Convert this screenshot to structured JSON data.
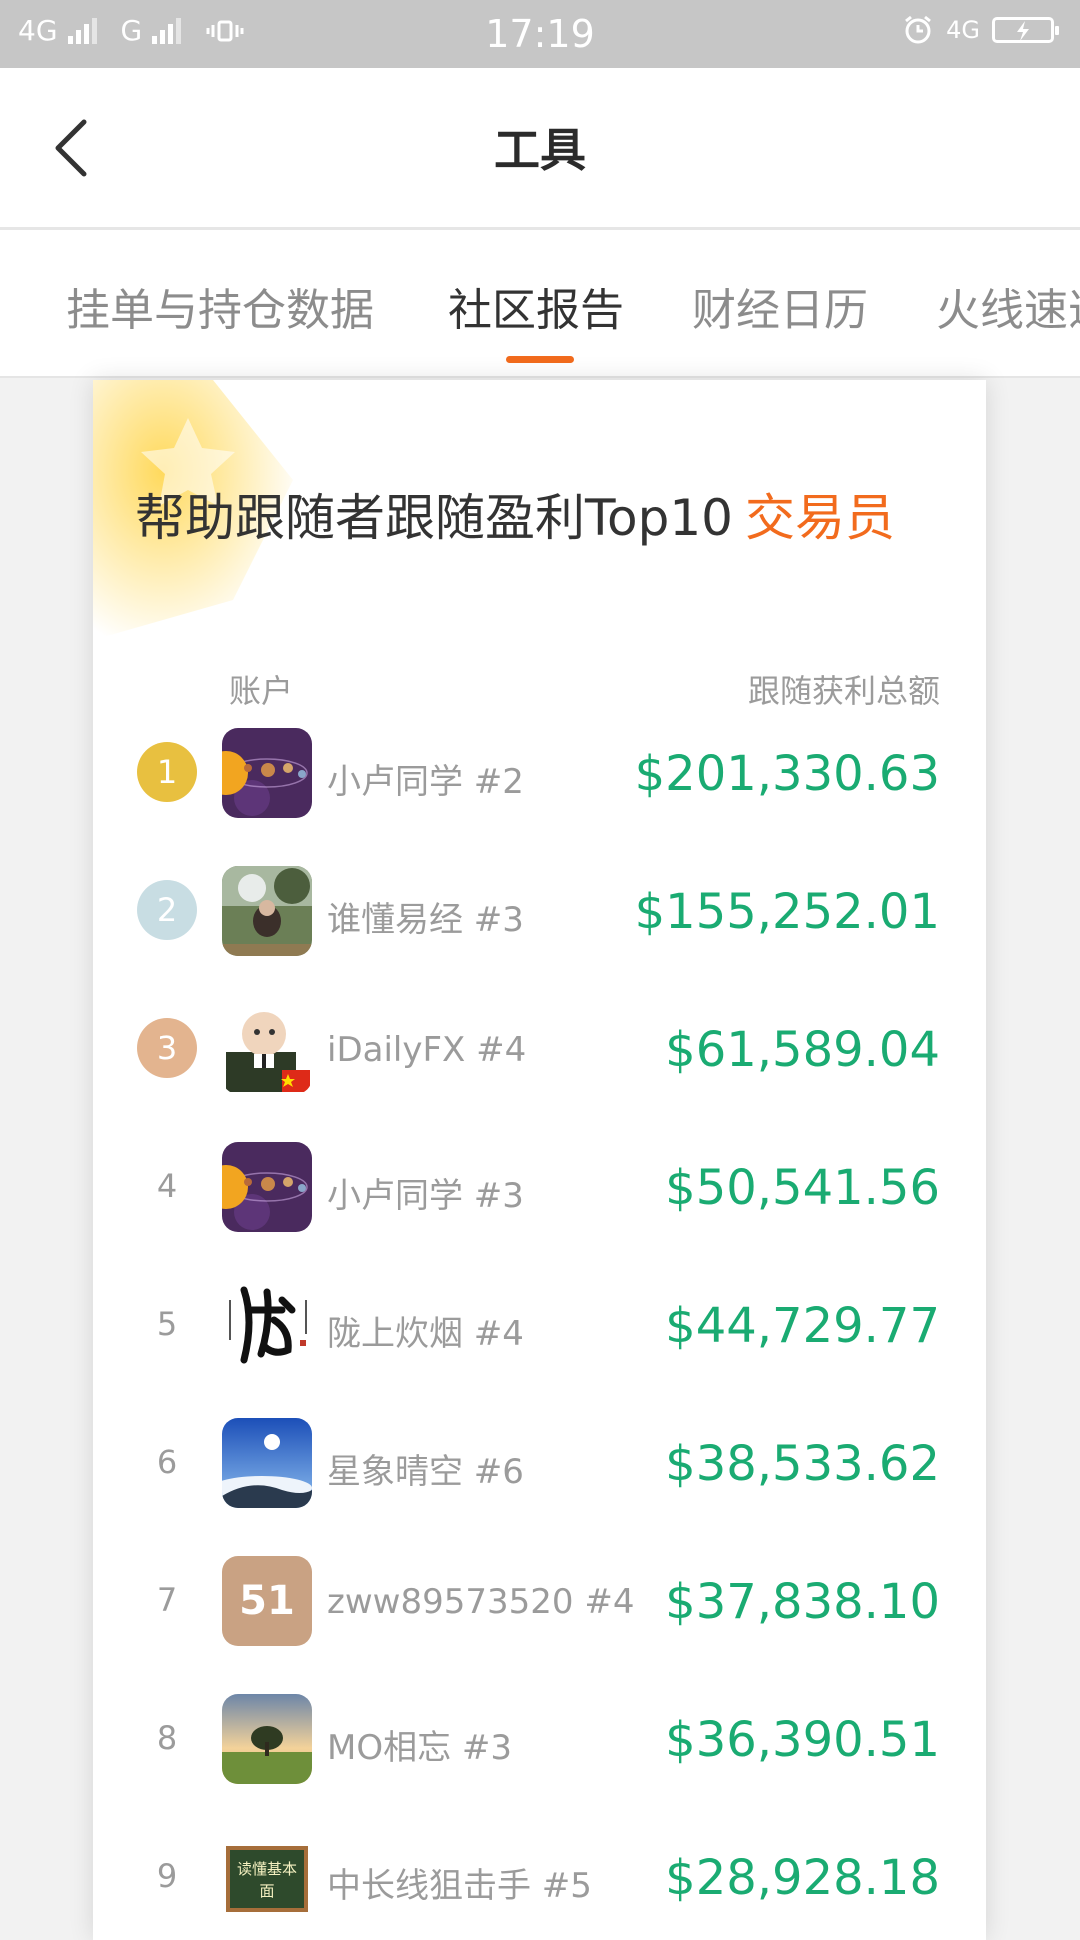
{
  "status_bar": {
    "network1": "4G",
    "network2": "G",
    "time": "17:19",
    "network3": "4G"
  },
  "header": {
    "title": "工具",
    "back_icon": "chevron-left-icon"
  },
  "tabs": [
    {
      "label": "挂单与持仓数据",
      "active": false
    },
    {
      "label": "社区报告",
      "active": true
    },
    {
      "label": "财经日历",
      "active": false
    },
    {
      "label": "火线速递",
      "active": false
    }
  ],
  "report": {
    "title": "帮助跟随者跟随盈利Top10",
    "title_accent": "交易员",
    "col_account": "账户",
    "col_total": "跟随获利总额",
    "colors": {
      "accent": "#f26b1d",
      "amount": "#1aab72",
      "gold": "#e8c040",
      "silver": "#c8dde3",
      "bronze": "#e3b48f"
    },
    "rows": [
      {
        "rank": "1",
        "name": "小卢同学 #2",
        "amount": "$201,330.63",
        "avatar": "planets"
      },
      {
        "rank": "2",
        "name": "谁懂易经 #3",
        "amount": "$155,252.01",
        "avatar": "person-photo"
      },
      {
        "rank": "3",
        "name": "iDailyFX #4",
        "amount": "$61,589.04",
        "avatar": "boss-baby"
      },
      {
        "rank": "4",
        "name": "小卢同学 #3",
        "amount": "$50,541.56",
        "avatar": "planets"
      },
      {
        "rank": "5",
        "name": "陇上炊烟 #4",
        "amount": "$44,729.77",
        "avatar": "calligraphy"
      },
      {
        "rank": "6",
        "name": "星象晴空 #6",
        "amount": "$38,533.62",
        "avatar": "sky"
      },
      {
        "rank": "7",
        "name": "zww89573520 #4",
        "amount": "$37,838.10",
        "avatar": "51",
        "avatar_text": "51"
      },
      {
        "rank": "8",
        "name": "MO相忘 #3",
        "amount": "$36,390.51",
        "avatar": "tree-field"
      },
      {
        "rank": "9",
        "name": "中长线狙击手 #5",
        "amount": "$28,928.18",
        "avatar": "blackboard",
        "avatar_text": "读懂基本面"
      }
    ]
  }
}
